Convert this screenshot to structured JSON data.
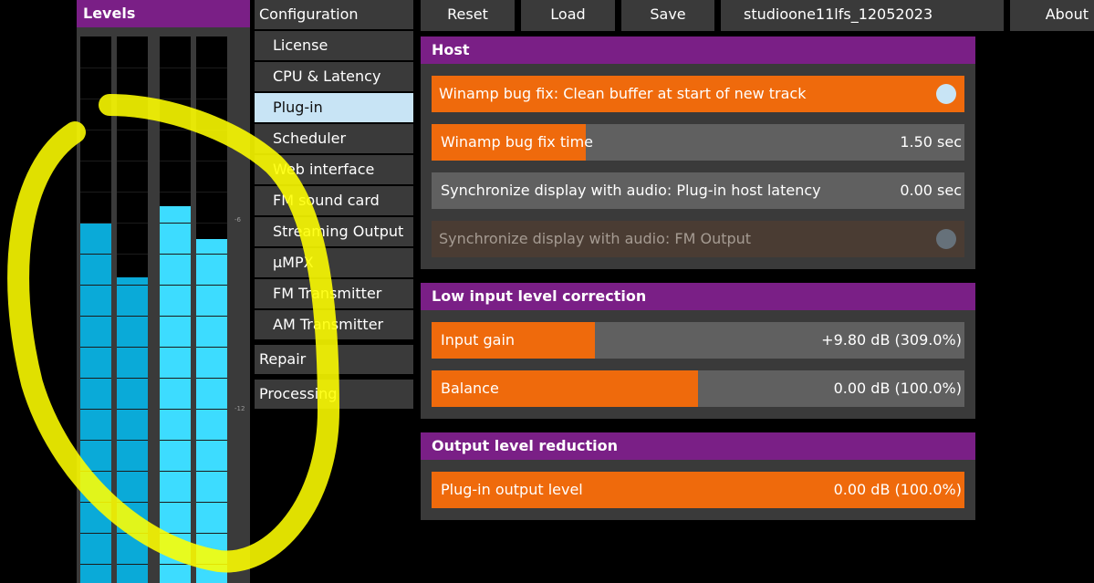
{
  "levels": {
    "title": "Levels",
    "tick_labels": [
      "-6",
      "-12"
    ],
    "meters": [
      {
        "level": 0.66
      },
      {
        "level": 0.56
      },
      {
        "level": 0.69
      },
      {
        "level": 0.63
      }
    ],
    "colors": {
      "meter": "#0aaad8",
      "meter_bright": "#3ddcff"
    }
  },
  "nav": {
    "configuration": "Configuration",
    "items": [
      {
        "label": "License",
        "active": false
      },
      {
        "label": "CPU & Latency",
        "active": false
      },
      {
        "label": "Plug-in",
        "active": true
      },
      {
        "label": "Scheduler",
        "active": false
      },
      {
        "label": "Web interface",
        "active": false
      },
      {
        "label": "FM sound card",
        "active": false
      },
      {
        "label": "Streaming Output",
        "active": false
      },
      {
        "label": "µMPX",
        "active": false
      },
      {
        "label": "FM Transmitter",
        "active": false
      },
      {
        "label": "AM Transmitter",
        "active": false
      }
    ],
    "repair": "Repair",
    "processing": "Processing"
  },
  "topbar": {
    "reset": "Reset",
    "load": "Load",
    "save": "Save",
    "preset_name": "studioone11lfs_12052023",
    "about": "About"
  },
  "host": {
    "title": "Host",
    "winamp_fix": {
      "label": "Winamp bug fix: Clean buffer at start of new track",
      "on": true
    },
    "winamp_time": {
      "label": "Winamp bug fix time",
      "value": "1.50 sec",
      "fill": 0.29
    },
    "sync_plugin": {
      "label": "Synchronize display with audio: Plug-in host latency",
      "value": "0.00 sec",
      "fill": 0.0
    },
    "sync_fm": {
      "label": "Synchronize display with audio: FM Output",
      "enabled": false
    }
  },
  "low_input": {
    "title": "Low input level correction",
    "input_gain": {
      "label": "Input gain",
      "value": "+9.80 dB (309.0%)",
      "fill": 0.306
    },
    "balance": {
      "label": "Balance",
      "value": "0.00 dB (100.0%)",
      "fill": 0.5
    }
  },
  "output": {
    "title": "Output level reduction",
    "plugin_output": {
      "label": "Plug-in output level",
      "value": "0.00 dB (100.0%)",
      "fill": 1.0
    }
  },
  "colors": {
    "accent_purple": "#7a1f86",
    "accent_orange": "#ef6a0c",
    "panel": "#3a3a3a",
    "toggle_on": "#c8e4f5",
    "annotation": "#ffff00"
  }
}
